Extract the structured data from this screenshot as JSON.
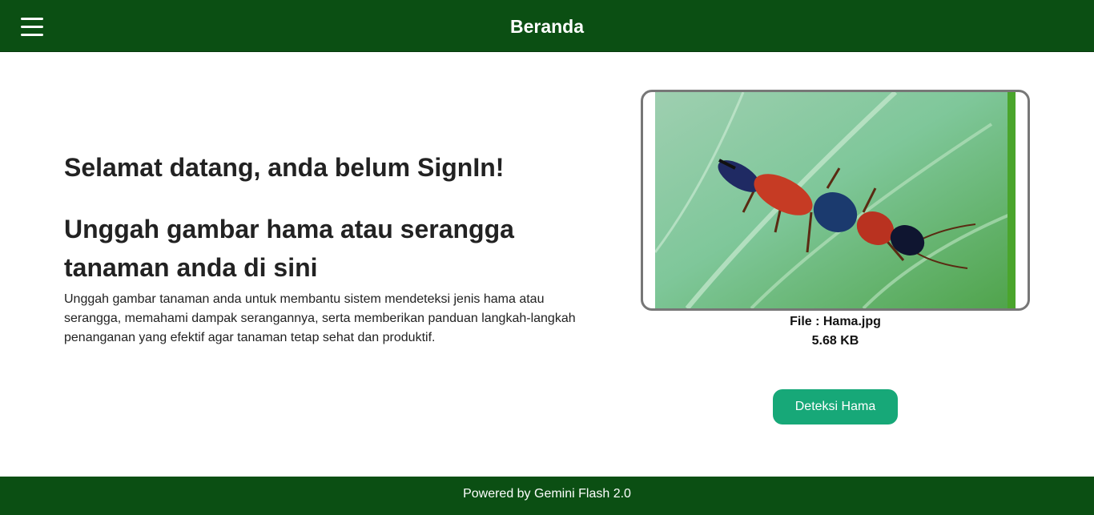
{
  "header": {
    "title": "Beranda",
    "menu_icon": "hamburger-menu-icon"
  },
  "main": {
    "welcome": "Selamat datang, anda belum SignIn!",
    "upload_heading": "Unggah gambar hama atau serangga tanaman anda di sini",
    "description": "Unggah gambar tanaman anda untuk membantu sistem mendeteksi jenis hama atau serangga, memahami dampak serangannya, serta memberikan panduan langkah-langkah penanganan yang efektif agar tanaman tetap sehat dan produktif."
  },
  "upload": {
    "file_name": "File : Hama.jpg",
    "file_size": "5.68 KB",
    "detect_label": "Deteksi Hama"
  },
  "footer": {
    "text": "Powered by Gemini Flash 2.0"
  },
  "colors": {
    "header_bg": "#0b4f13",
    "button_bg": "#17a878"
  }
}
